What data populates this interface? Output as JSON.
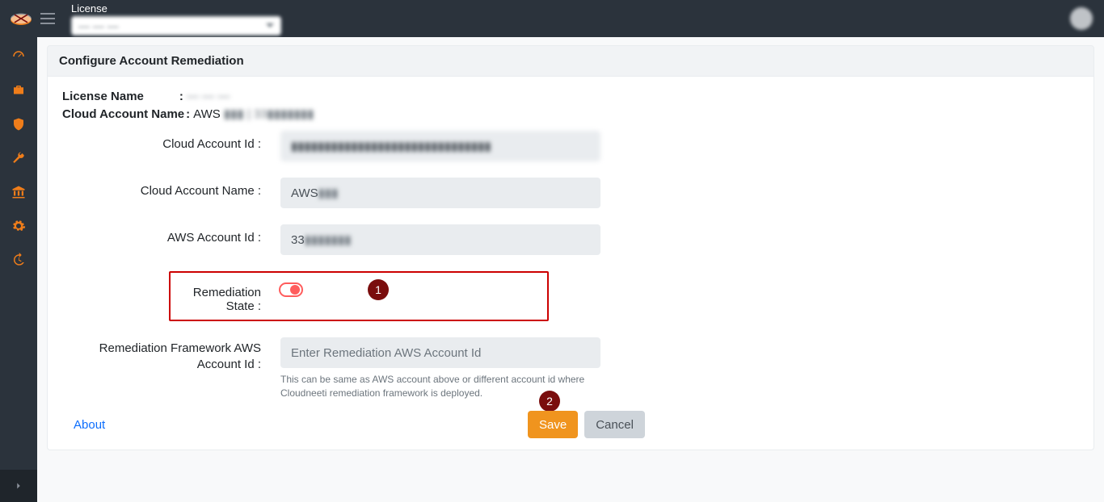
{
  "header": {
    "license_label": "License",
    "license_selected": "— — —",
    "avatar_alt": "User"
  },
  "sidebar": {
    "items": [
      "dashboard",
      "briefcase",
      "shield",
      "wrench",
      "institution",
      "gear",
      "history"
    ]
  },
  "page": {
    "title": "Configure Account Remediation",
    "license_name_label": "License Name",
    "license_name_value": "— — —",
    "cloud_account_name_label": "Cloud Account Name",
    "cloud_account_name_prefix": "AWS",
    "cloud_account_name_rest": "▮▮▮ | 33▮▮▮▮▮▮▮",
    "form": {
      "cloud_account_id_label": "Cloud Account Id :",
      "cloud_account_id_value": "▮▮▮▮▮▮▮▮▮▮▮▮▮▮▮▮▮▮▮▮▮▮▮▮▮▮▮▮▮▮",
      "cloud_account_name_label": "Cloud Account Name :",
      "cloud_account_name_value": "AWS▮▮▮",
      "aws_account_id_label": "AWS Account Id :",
      "aws_account_id_value": "33▮▮▮▮▮▮▮",
      "remediation_state_label": "Remediation State :",
      "remediation_state_on": false,
      "remediation_fw_label": "Remediation Framework AWS Account Id :",
      "remediation_fw_placeholder": "Enter Remediation AWS Account Id",
      "remediation_fw_help": "This can be same as AWS account above or different account id where Cloudneeti remediation framework is deployed."
    },
    "steps": {
      "one": "1",
      "two": "2"
    },
    "about_label": "About",
    "save_label": "Save",
    "cancel_label": "Cancel"
  }
}
